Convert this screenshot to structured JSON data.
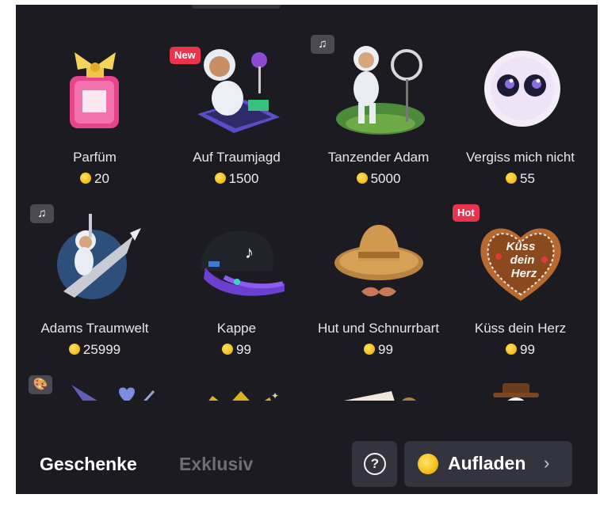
{
  "gifts": [
    {
      "name": "Parfüm",
      "price": "20",
      "badge": "",
      "icon": "perfume-bottle"
    },
    {
      "name": "Auf Traumjagd",
      "price": "1500",
      "badge": "New",
      "icon": "astronaut-dj"
    },
    {
      "name": "Tanzender Adam",
      "price": "5000",
      "badge": "",
      "icon": "dancing-astronaut",
      "badge_icon": "music-note"
    },
    {
      "name": "Vergiss mich nicht",
      "price": "55",
      "badge": "",
      "icon": "fluffy-creature"
    },
    {
      "name": "Adams Traumwelt",
      "price": "25999",
      "badge": "",
      "icon": "astronaut-rocket",
      "badge_icon": "music-note"
    },
    {
      "name": "Kappe",
      "price": "99",
      "badge": "",
      "icon": "baseball-cap"
    },
    {
      "name": "Hut und Schnurrbart",
      "price": "99",
      "badge": "",
      "icon": "hat-mustache"
    },
    {
      "name": "Küss dein Herz",
      "price": "99",
      "badge": "Hot",
      "icon": "gingerbread-heart",
      "heart_text": [
        "Küss",
        "dein",
        "Herz"
      ]
    }
  ],
  "bottom_row_badge_icon": "palette",
  "tabs": {
    "gifts": "Geschenke",
    "exclusive": "Exklusiv"
  },
  "help_symbol": "?",
  "recharge": {
    "label": "Aufladen",
    "chevron": "›"
  },
  "colors": {
    "background": "#1b1b21",
    "badge_red": "#e8344d",
    "coin": "#f6c018",
    "button_bg": "#34343f"
  }
}
